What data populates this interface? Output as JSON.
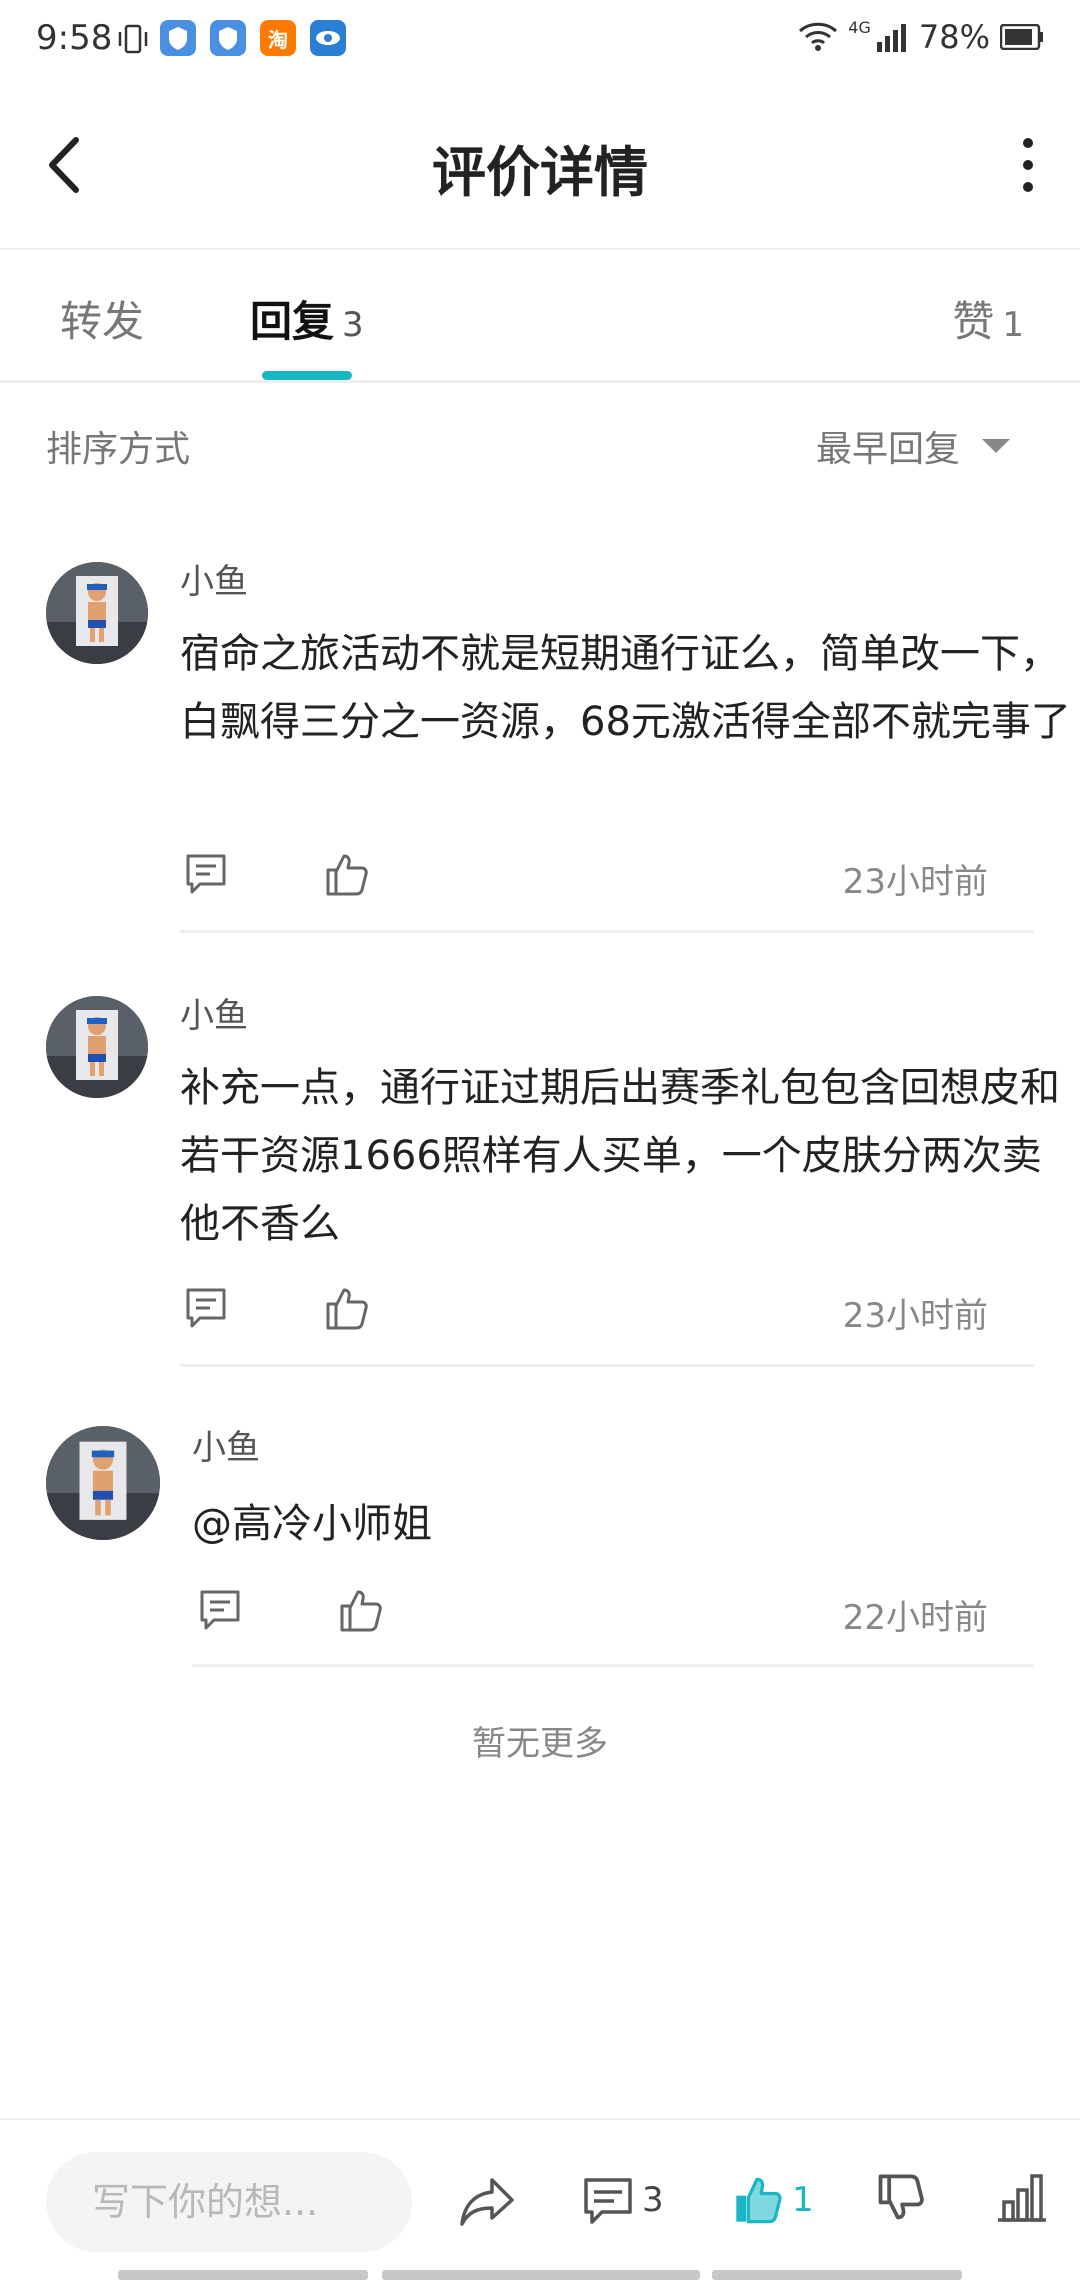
{
  "status_bar": {
    "time": "9:58",
    "network": "4G",
    "battery": "78%",
    "app_icon_colors": [
      "#4a90e2",
      "#4a90e2",
      "#ff7a00",
      "#2a7fd4"
    ],
    "app_icon_badge": "淘"
  },
  "header": {
    "title": "评价详情"
  },
  "tabs": [
    {
      "label": "转发",
      "count": ""
    },
    {
      "label": "回复",
      "count": "3"
    },
    {
      "label": "赞",
      "count": "1"
    }
  ],
  "sort": {
    "label": "排序方式",
    "value": "最早回复"
  },
  "comments": [
    {
      "user": "小鱼",
      "text": "宿命之旅活动不就是短期通行证么，简单改一下，白飘得三分之一资源，68元激活得全部不就完事了",
      "time": "23小时前"
    },
    {
      "user": "小鱼",
      "text": "补充一点，通行证过期后出赛季礼包包含回想皮和若干资源1666照样有人买单，一个皮肤分两次卖他不香么",
      "time": "23小时前"
    },
    {
      "user": "小鱼",
      "text": "@高冷小师姐",
      "time": "22小时前"
    }
  ],
  "footer": {
    "no_more": "暂无更多"
  },
  "bottom_bar": {
    "placeholder": "写下你的想...",
    "comment_count": "3",
    "like_count": "1"
  },
  "colors": {
    "accent": "#19b6c4",
    "text_primary": "#222222",
    "text_secondary": "#888888"
  }
}
